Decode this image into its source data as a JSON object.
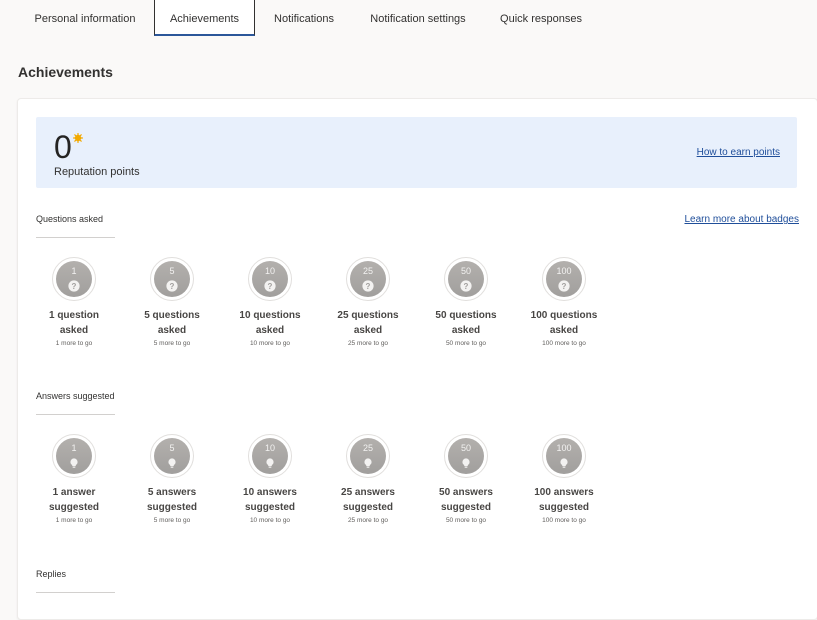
{
  "tabs": [
    {
      "label": "Personal information",
      "active": false
    },
    {
      "label": "Achievements",
      "active": true
    },
    {
      "label": "Notifications",
      "active": false
    },
    {
      "label": "Notification settings",
      "active": false
    },
    {
      "label": "Quick responses",
      "active": false
    }
  ],
  "page_title": "Achievements",
  "reputation": {
    "value": "0",
    "label": "Reputation points",
    "link": "How to earn points",
    "star_color": "#f2a900"
  },
  "badges_link": "Learn more about badges",
  "colors": {
    "accent": "#2b579a",
    "link": "#1f4e9a",
    "banner": "#e8f0fc"
  },
  "sections": [
    {
      "title": "Questions asked",
      "icon": "question-icon",
      "badges": [
        {
          "number": "1",
          "title_line1": "1 question",
          "title_line2": "asked",
          "progress": "1 more to go"
        },
        {
          "number": "5",
          "title_line1": "5 questions",
          "title_line2": "asked",
          "progress": "5 more to go"
        },
        {
          "number": "10",
          "title_line1": "10 questions",
          "title_line2": "asked",
          "progress": "10 more to go"
        },
        {
          "number": "25",
          "title_line1": "25 questions",
          "title_line2": "asked",
          "progress": "25 more to go"
        },
        {
          "number": "50",
          "title_line1": "50 questions",
          "title_line2": "asked",
          "progress": "50 more to go"
        },
        {
          "number": "100",
          "title_line1": "100 questions",
          "title_line2": "asked",
          "progress": "100 more to go"
        }
      ]
    },
    {
      "title": "Answers suggested",
      "icon": "lightbulb-icon",
      "badges": [
        {
          "number": "1",
          "title_line1": "1 answer",
          "title_line2": "suggested",
          "progress": "1 more to go"
        },
        {
          "number": "5",
          "title_line1": "5 answers",
          "title_line2": "suggested",
          "progress": "5 more to go"
        },
        {
          "number": "10",
          "title_line1": "10 answers",
          "title_line2": "suggested",
          "progress": "10 more to go"
        },
        {
          "number": "25",
          "title_line1": "25 answers",
          "title_line2": "suggested",
          "progress": "25 more to go"
        },
        {
          "number": "50",
          "title_line1": "50 answers",
          "title_line2": "suggested",
          "progress": "50 more to go"
        },
        {
          "number": "100",
          "title_line1": "100 answers",
          "title_line2": "suggested",
          "progress": "100 more to go"
        }
      ]
    },
    {
      "title": "Replies",
      "icon": "",
      "badges": []
    }
  ]
}
